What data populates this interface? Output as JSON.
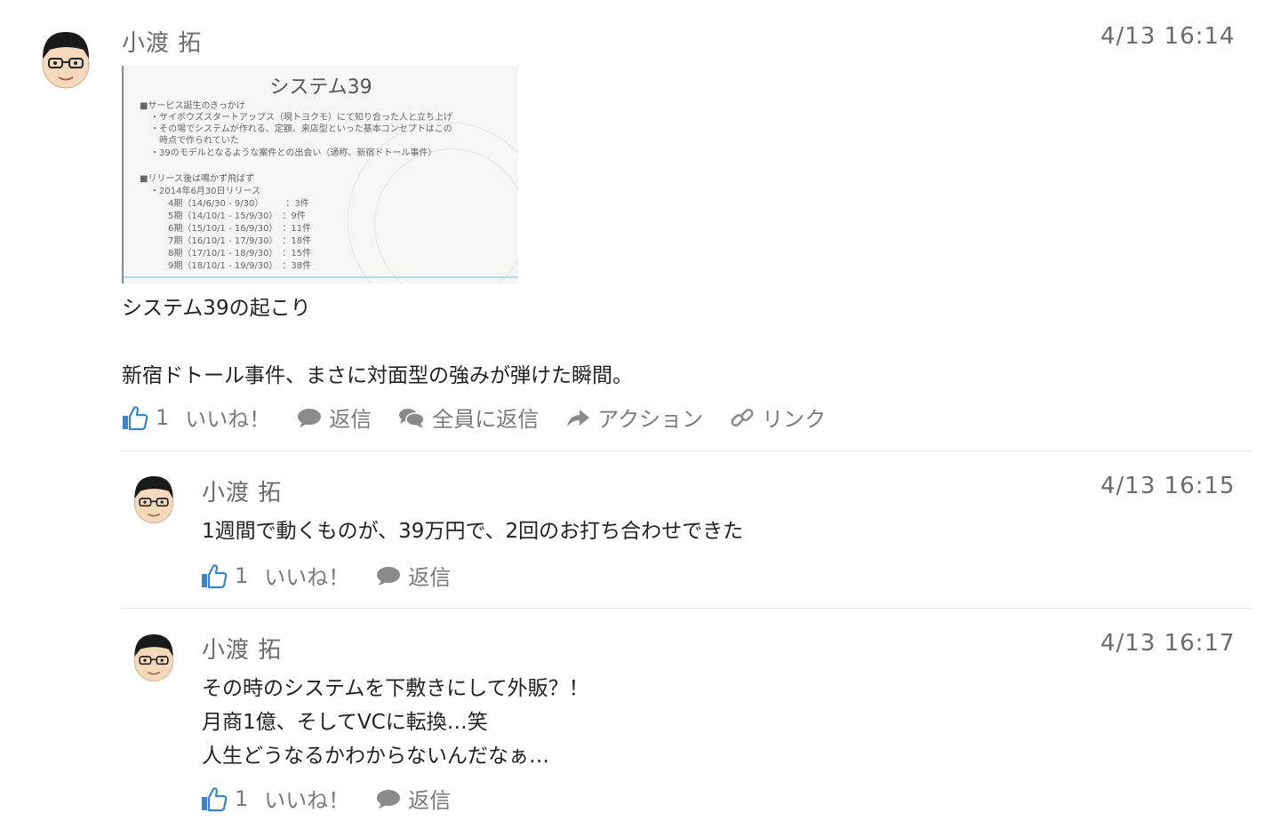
{
  "posts": [
    {
      "author": "小渡 拓",
      "time": "4/13 16:14",
      "attachment": {
        "title": "システム39",
        "lines": [
          "■サービス誕生のきっかけ",
          "・サイボウズスタートアップス（現トヨクモ）にて知り合った人と立ち上げ",
          "・その場でシステムが作れる、定額、来店型といった基本コンセプトはこの",
          "　時点で作られていた",
          "・39のモデルとなるような案件との出会い（通称、新宿ドトール事件）",
          "■リリース後は鳴かず飛ばず",
          "・2014年6月30日リリース",
          "4期（14/6/30 - 9/30）　　　：3件",
          "5期（14/10/1 - 15/9/30）　：9件",
          "6期（15/10/1 - 16/9/30）　：11件",
          "7期（16/10/1 - 17/9/30）　：18件",
          "8期（17/10/1 - 18/9/30）　：15件",
          "9期（18/10/1 - 19/9/30）　：38件"
        ]
      },
      "text_lines": [
        "システム39の起こり",
        "",
        "新宿ドトール事件、まさに対面型の強みが弾けた瞬間。"
      ],
      "like_count": "1",
      "like_label": "いいね！",
      "reply_label": "返信",
      "reply_all_label": "全員に返信",
      "action_label": "アクション",
      "link_label": "リンク"
    },
    {
      "author": "小渡 拓",
      "time": "4/13 16:15",
      "text_lines": [
        "1週間で動くものが、39万円で、2回のお打ち合わせできた"
      ],
      "like_count": "1",
      "like_label": "いいね！",
      "reply_label": "返信"
    },
    {
      "author": "小渡 拓",
      "time": "4/13 16:17",
      "text_lines": [
        "その時のシステムを下敷きにして外販？！",
        "月商1億、そしてVCに転換…笑",
        "人生どうなるかわからないんだなぁ…"
      ],
      "like_count": "1",
      "like_label": "いいね！",
      "reply_label": "返信"
    }
  ],
  "colors": {
    "like_icon": "#3b84c9",
    "muted": "#7a7a7a",
    "text": "#222222"
  }
}
